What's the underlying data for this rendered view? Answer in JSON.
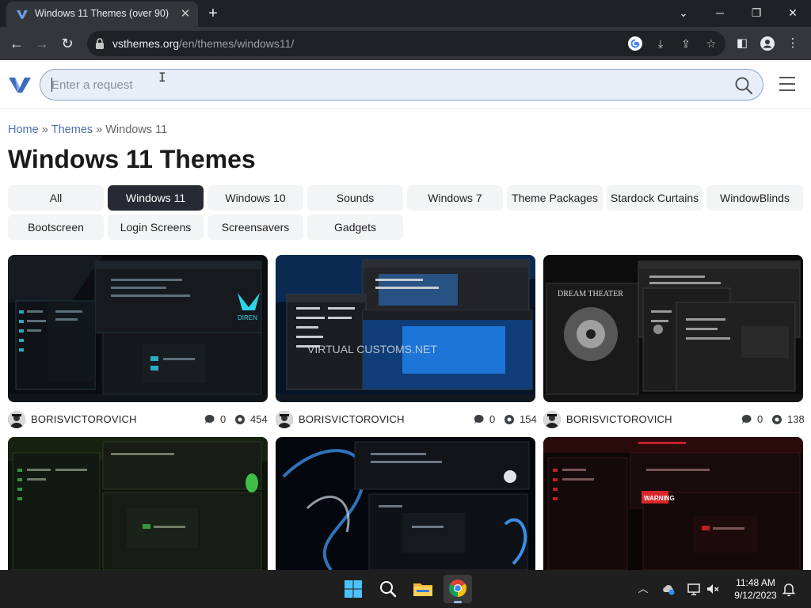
{
  "browser": {
    "tab_title": "Windows 11 Themes (over 90)",
    "url_domain": "vsthemes.org",
    "url_path": "/en/themes/windows11/"
  },
  "site": {
    "search_placeholder": "Enter a request"
  },
  "breadcrumb": [
    "Home",
    "Themes",
    "Windows 11"
  ],
  "breadcrumb_separator": "»",
  "page_title": "Windows 11 Themes",
  "categories": [
    {
      "label": "All",
      "active": false
    },
    {
      "label": "Windows 11",
      "active": true
    },
    {
      "label": "Windows 10",
      "active": false
    },
    {
      "label": "Sounds",
      "active": false
    },
    {
      "label": "Windows 7",
      "active": false
    },
    {
      "label": "Theme Packages",
      "active": false
    },
    {
      "label": "Stardock Curtains",
      "active": false
    },
    {
      "label": "WindowBlinds",
      "active": false
    },
    {
      "label": "Bootscreen",
      "active": false
    },
    {
      "label": "Login Screens",
      "active": false
    },
    {
      "label": "Screensavers",
      "active": false
    },
    {
      "label": "Gadgets",
      "active": false
    }
  ],
  "cards": [
    {
      "author": "BORISVICTOROVICH",
      "comments": "0",
      "views": "454",
      "accent": "#2fd3e6",
      "wallpaper_text": "DIREN"
    },
    {
      "author": "BORISVICTOROVICH",
      "comments": "0",
      "views": "154",
      "accent": "#2e7de0",
      "wallpaper_text": "VIRTUAL CUSTOMS.NET"
    },
    {
      "author": "BORISVICTOROVICH",
      "comments": "0",
      "views": "138",
      "accent": "#9a9a9a",
      "wallpaper_text": "DREAM THEATER"
    },
    {
      "accent": "#3fbf4a"
    },
    {
      "accent": "#3a8ee8"
    },
    {
      "accent": "#d8262b",
      "wallpaper_text": "WARNING"
    }
  ],
  "taskbar": {
    "time": "11:48 AM",
    "date": "9/12/2023"
  },
  "colors": {
    "active_chip": "#262b33",
    "link": "#4f6fae",
    "search_fill": "#e8eef8"
  }
}
